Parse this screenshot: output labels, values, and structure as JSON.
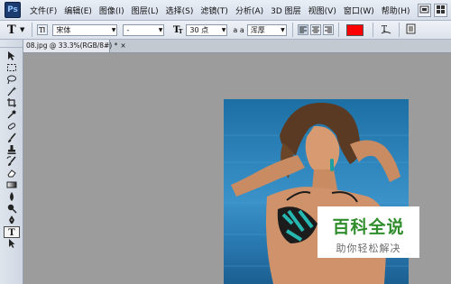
{
  "app": {
    "logo": "Ps"
  },
  "menu": {
    "items": [
      "文件(F)",
      "编辑(E)",
      "图像(I)",
      "图层(L)",
      "选择(S)",
      "滤镜(T)",
      "分析(A)",
      "3D 图层",
      "视图(V)",
      "窗口(W)",
      "帮助(H)"
    ]
  },
  "options": {
    "tool_glyph": "T",
    "font_family": "宋体",
    "font_style": "-",
    "font_size": "30 点",
    "aa_label": "a a",
    "antialias": "浑厚",
    "text_color": "#ff0000"
  },
  "document": {
    "tab_title": "08.jpg @ 33.3%(RGB/8#) *",
    "close_glyph": "×"
  },
  "toolbox": {
    "tools": [
      "move-tool",
      "marquee-tool",
      "lasso-tool",
      "magic-wand-tool",
      "crop-tool",
      "eyedropper-tool",
      "healing-brush-tool",
      "brush-tool",
      "clone-stamp-tool",
      "history-brush-tool",
      "eraser-tool",
      "gradient-tool",
      "blur-tool",
      "dodge-tool",
      "pen-tool",
      "type-tool",
      "path-select-tool"
    ]
  },
  "watermark": {
    "title": "百科全说",
    "subtitle": "助你轻松解决"
  }
}
